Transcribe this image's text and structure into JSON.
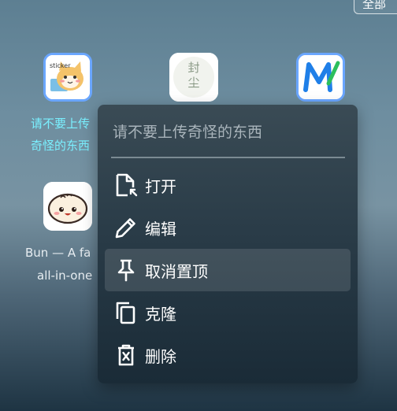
{
  "top_button": {
    "label": "全部"
  },
  "apps": [
    {
      "label_line1": "请不要上传",
      "label_line2": "奇怪的东西",
      "icon": "cat-sticker-icon",
      "selected": true
    },
    {
      "icon": "fengchen-seal-icon",
      "icon_text": "封尘"
    },
    {
      "icon": "markdown-m-icon"
    },
    {
      "label_line1": "Bun — A fa",
      "label_line2": "all-in-one",
      "icon": "bun-dumpling-icon"
    }
  ],
  "context_menu": {
    "title": "请不要上传奇怪的东西",
    "items": [
      {
        "label": "打开",
        "icon": "open-file-icon"
      },
      {
        "label": "编辑",
        "icon": "pencil-icon"
      },
      {
        "label": "取消置顶",
        "icon": "pin-icon",
        "hovered": true
      },
      {
        "label": "克隆",
        "icon": "copy-icon"
      },
      {
        "label": "删除",
        "icon": "trash-icon"
      }
    ]
  }
}
